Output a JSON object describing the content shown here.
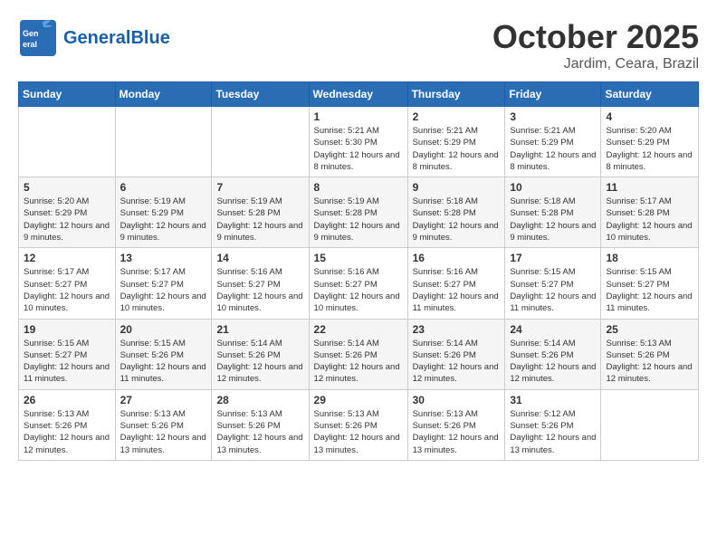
{
  "header": {
    "logo_general": "General",
    "logo_blue": "Blue",
    "month": "October 2025",
    "location": "Jardim, Ceara, Brazil"
  },
  "days_of_week": [
    "Sunday",
    "Monday",
    "Tuesday",
    "Wednesday",
    "Thursday",
    "Friday",
    "Saturday"
  ],
  "weeks": [
    [
      {
        "day": "",
        "sunrise": "",
        "sunset": "",
        "daylight": ""
      },
      {
        "day": "",
        "sunrise": "",
        "sunset": "",
        "daylight": ""
      },
      {
        "day": "",
        "sunrise": "",
        "sunset": "",
        "daylight": ""
      },
      {
        "day": "1",
        "sunrise": "Sunrise: 5:21 AM",
        "sunset": "Sunset: 5:30 PM",
        "daylight": "Daylight: 12 hours and 8 minutes."
      },
      {
        "day": "2",
        "sunrise": "Sunrise: 5:21 AM",
        "sunset": "Sunset: 5:29 PM",
        "daylight": "Daylight: 12 hours and 8 minutes."
      },
      {
        "day": "3",
        "sunrise": "Sunrise: 5:21 AM",
        "sunset": "Sunset: 5:29 PM",
        "daylight": "Daylight: 12 hours and 8 minutes."
      },
      {
        "day": "4",
        "sunrise": "Sunrise: 5:20 AM",
        "sunset": "Sunset: 5:29 PM",
        "daylight": "Daylight: 12 hours and 8 minutes."
      }
    ],
    [
      {
        "day": "5",
        "sunrise": "Sunrise: 5:20 AM",
        "sunset": "Sunset: 5:29 PM",
        "daylight": "Daylight: 12 hours and 9 minutes."
      },
      {
        "day": "6",
        "sunrise": "Sunrise: 5:19 AM",
        "sunset": "Sunset: 5:29 PM",
        "daylight": "Daylight: 12 hours and 9 minutes."
      },
      {
        "day": "7",
        "sunrise": "Sunrise: 5:19 AM",
        "sunset": "Sunset: 5:28 PM",
        "daylight": "Daylight: 12 hours and 9 minutes."
      },
      {
        "day": "8",
        "sunrise": "Sunrise: 5:19 AM",
        "sunset": "Sunset: 5:28 PM",
        "daylight": "Daylight: 12 hours and 9 minutes."
      },
      {
        "day": "9",
        "sunrise": "Sunrise: 5:18 AM",
        "sunset": "Sunset: 5:28 PM",
        "daylight": "Daylight: 12 hours and 9 minutes."
      },
      {
        "day": "10",
        "sunrise": "Sunrise: 5:18 AM",
        "sunset": "Sunset: 5:28 PM",
        "daylight": "Daylight: 12 hours and 9 minutes."
      },
      {
        "day": "11",
        "sunrise": "Sunrise: 5:17 AM",
        "sunset": "Sunset: 5:28 PM",
        "daylight": "Daylight: 12 hours and 10 minutes."
      }
    ],
    [
      {
        "day": "12",
        "sunrise": "Sunrise: 5:17 AM",
        "sunset": "Sunset: 5:27 PM",
        "daylight": "Daylight: 12 hours and 10 minutes."
      },
      {
        "day": "13",
        "sunrise": "Sunrise: 5:17 AM",
        "sunset": "Sunset: 5:27 PM",
        "daylight": "Daylight: 12 hours and 10 minutes."
      },
      {
        "day": "14",
        "sunrise": "Sunrise: 5:16 AM",
        "sunset": "Sunset: 5:27 PM",
        "daylight": "Daylight: 12 hours and 10 minutes."
      },
      {
        "day": "15",
        "sunrise": "Sunrise: 5:16 AM",
        "sunset": "Sunset: 5:27 PM",
        "daylight": "Daylight: 12 hours and 10 minutes."
      },
      {
        "day": "16",
        "sunrise": "Sunrise: 5:16 AM",
        "sunset": "Sunset: 5:27 PM",
        "daylight": "Daylight: 12 hours and 11 minutes."
      },
      {
        "day": "17",
        "sunrise": "Sunrise: 5:15 AM",
        "sunset": "Sunset: 5:27 PM",
        "daylight": "Daylight: 12 hours and 11 minutes."
      },
      {
        "day": "18",
        "sunrise": "Sunrise: 5:15 AM",
        "sunset": "Sunset: 5:27 PM",
        "daylight": "Daylight: 12 hours and 11 minutes."
      }
    ],
    [
      {
        "day": "19",
        "sunrise": "Sunrise: 5:15 AM",
        "sunset": "Sunset: 5:27 PM",
        "daylight": "Daylight: 12 hours and 11 minutes."
      },
      {
        "day": "20",
        "sunrise": "Sunrise: 5:15 AM",
        "sunset": "Sunset: 5:26 PM",
        "daylight": "Daylight: 12 hours and 11 minutes."
      },
      {
        "day": "21",
        "sunrise": "Sunrise: 5:14 AM",
        "sunset": "Sunset: 5:26 PM",
        "daylight": "Daylight: 12 hours and 12 minutes."
      },
      {
        "day": "22",
        "sunrise": "Sunrise: 5:14 AM",
        "sunset": "Sunset: 5:26 PM",
        "daylight": "Daylight: 12 hours and 12 minutes."
      },
      {
        "day": "23",
        "sunrise": "Sunrise: 5:14 AM",
        "sunset": "Sunset: 5:26 PM",
        "daylight": "Daylight: 12 hours and 12 minutes."
      },
      {
        "day": "24",
        "sunrise": "Sunrise: 5:14 AM",
        "sunset": "Sunset: 5:26 PM",
        "daylight": "Daylight: 12 hours and 12 minutes."
      },
      {
        "day": "25",
        "sunrise": "Sunrise: 5:13 AM",
        "sunset": "Sunset: 5:26 PM",
        "daylight": "Daylight: 12 hours and 12 minutes."
      }
    ],
    [
      {
        "day": "26",
        "sunrise": "Sunrise: 5:13 AM",
        "sunset": "Sunset: 5:26 PM",
        "daylight": "Daylight: 12 hours and 12 minutes."
      },
      {
        "day": "27",
        "sunrise": "Sunrise: 5:13 AM",
        "sunset": "Sunset: 5:26 PM",
        "daylight": "Daylight: 12 hours and 13 minutes."
      },
      {
        "day": "28",
        "sunrise": "Sunrise: 5:13 AM",
        "sunset": "Sunset: 5:26 PM",
        "daylight": "Daylight: 12 hours and 13 minutes."
      },
      {
        "day": "29",
        "sunrise": "Sunrise: 5:13 AM",
        "sunset": "Sunset: 5:26 PM",
        "daylight": "Daylight: 12 hours and 13 minutes."
      },
      {
        "day": "30",
        "sunrise": "Sunrise: 5:13 AM",
        "sunset": "Sunset: 5:26 PM",
        "daylight": "Daylight: 12 hours and 13 minutes."
      },
      {
        "day": "31",
        "sunrise": "Sunrise: 5:12 AM",
        "sunset": "Sunset: 5:26 PM",
        "daylight": "Daylight: 12 hours and 13 minutes."
      },
      {
        "day": "",
        "sunrise": "",
        "sunset": "",
        "daylight": ""
      }
    ]
  ]
}
